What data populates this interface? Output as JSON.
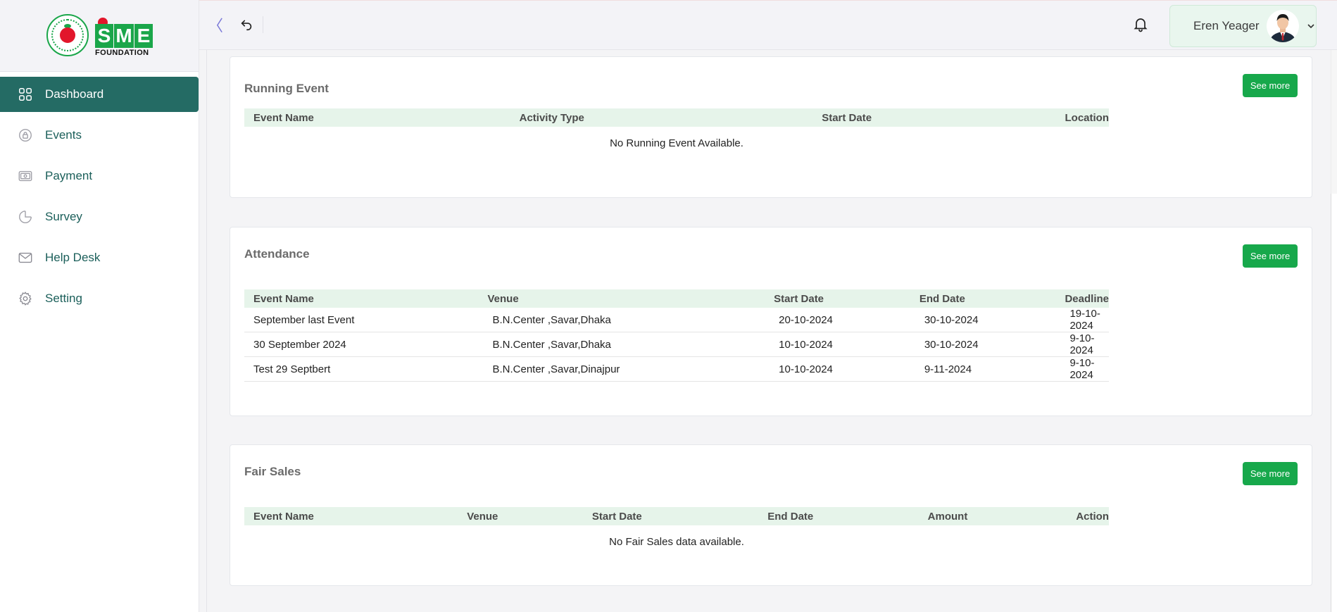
{
  "brand": {
    "logo_text_letters": [
      "S",
      "M",
      "E"
    ],
    "logo_subtitle": "FOUNDATION"
  },
  "sidebar": {
    "items": [
      {
        "label": "Dashboard",
        "icon": "grid-icon",
        "active": true
      },
      {
        "label": "Events",
        "icon": "lock-icon"
      },
      {
        "label": "Payment",
        "icon": "banknote-icon"
      },
      {
        "label": "Survey",
        "icon": "pie-chart-icon"
      },
      {
        "label": "Help Desk",
        "icon": "mail-icon"
      },
      {
        "label": "Setting",
        "icon": "gear-icon"
      }
    ]
  },
  "topbar": {
    "collapse_glyph": "〈",
    "user_name": "Eren Yeager"
  },
  "running_event": {
    "title": "Running Event",
    "see_more": "See more",
    "columns": [
      "Event Name",
      "Activity Type",
      "Start Date",
      "Location"
    ],
    "empty_text": "No Running Event Available."
  },
  "attendance": {
    "title": "Attendance",
    "see_more": "See more",
    "columns": [
      "Event Name",
      "Venue",
      "Start Date",
      "End Date",
      "Deadline"
    ],
    "rows": [
      [
        "September last Event",
        "B.N.Center ,Savar,Dhaka",
        "20-10-2024",
        "30-10-2024",
        "19-10-2024"
      ],
      [
        "30 September 2024",
        "B.N.Center ,Savar,Dhaka",
        "10-10-2024",
        "30-10-2024",
        "9-10-2024"
      ],
      [
        "Test 29 Septbert",
        "B.N.Center ,Savar,Dinajpur",
        "10-10-2024",
        "9-11-2024",
        "9-10-2024"
      ]
    ]
  },
  "fair_sales": {
    "title": "Fair Sales",
    "see_more": "See more",
    "columns": [
      "Event Name",
      "Venue",
      "Start Date",
      "End Date",
      "Amount",
      "Action"
    ],
    "empty_text": "No Fair Sales data available."
  },
  "colors": {
    "primary": "#246b64",
    "accent_green": "#17a84b",
    "table_header": "#e6f4ea"
  }
}
